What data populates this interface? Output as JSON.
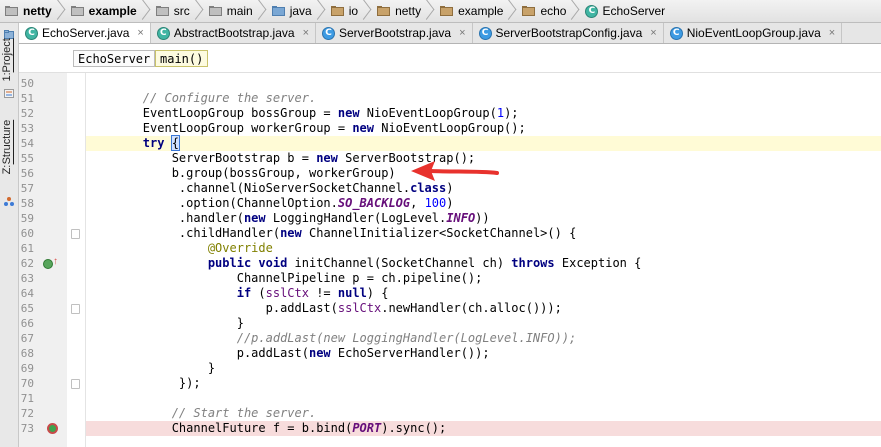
{
  "breadcrumbs": [
    {
      "label": "netty",
      "icon": "folder-icon"
    },
    {
      "label": "example",
      "icon": "folder-icon"
    },
    {
      "label": "src",
      "icon": "folder-icon"
    },
    {
      "label": "main",
      "icon": "folder-icon"
    },
    {
      "label": "java",
      "icon": "folder-icon"
    },
    {
      "label": "io",
      "icon": "package-icon"
    },
    {
      "label": "netty",
      "icon": "package-icon"
    },
    {
      "label": "example",
      "icon": "package-icon"
    },
    {
      "label": "echo",
      "icon": "package-icon"
    },
    {
      "label": "EchoServer",
      "icon": "class-icon"
    }
  ],
  "left_toolbar": {
    "project_label_prefix": "1: ",
    "project_label": "Project",
    "structure_label_prefix": "Z: ",
    "structure_label": "Structure"
  },
  "tabs": [
    {
      "label": "EchoServer.java",
      "close": "×",
      "active": true
    },
    {
      "label": "AbstractBootstrap.java",
      "close": "×",
      "active": false
    },
    {
      "label": "ServerBootstrap.java",
      "close": "×",
      "active": false
    },
    {
      "label": "ServerBootstrapConfig.java",
      "close": "×",
      "active": false
    },
    {
      "label": "NioEventLoopGroup.java",
      "close": "×",
      "active": false
    }
  ],
  "method_breadcrumbs": [
    "EchoServer",
    "main()"
  ],
  "editor": {
    "line_numbers": [
      "50",
      "51",
      "52",
      "53",
      "54",
      "55",
      "56",
      "57",
      "58",
      "59",
      "60",
      "61",
      "62",
      "63",
      "64",
      "65",
      "66",
      "67",
      "68",
      "69",
      "70",
      "71",
      "72",
      "73"
    ],
    "current_line": "54",
    "breakpoint_line": "73",
    "override_line": "62"
  },
  "annotation": {
    "arrow_color": "#e8322d",
    "points_to_line": "56"
  },
  "colors": {
    "keyword": "#000080",
    "comment": "#808080",
    "number": "#0000ff",
    "static_field": "#660e7a",
    "annotation": "#808000",
    "breakpoint": "#3da34d"
  }
}
